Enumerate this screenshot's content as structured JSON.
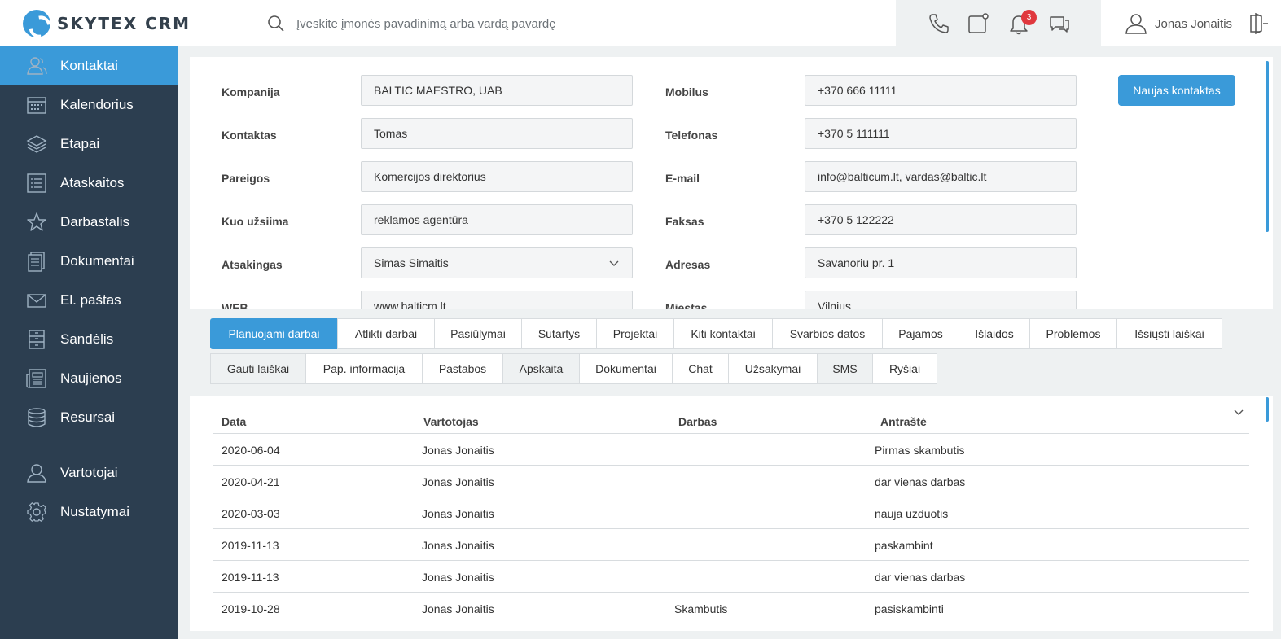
{
  "app": {
    "logo_text": "SKYTEX CRM",
    "logo_icon": "skytex-logo-icon",
    "accent_color": "#3a9ad9",
    "sidebar_color": "#2c3e50"
  },
  "header": {
    "search": {
      "placeholder": "Įveskite įmonės pavadinimą arba vardą pavardę",
      "icon": "search-icon"
    },
    "icons": [
      "phone-icon",
      "note-icon",
      "bell-icon",
      "chat-icon"
    ],
    "notification_count": "3",
    "user_name": "Jonas Jonaitis",
    "logout_icon": "logout-icon"
  },
  "sidebar": {
    "items": [
      {
        "label": "Kontaktai",
        "icon": "contacts-icon",
        "active": true
      },
      {
        "label": "Kalendorius",
        "icon": "calendar-icon"
      },
      {
        "label": "Etapai",
        "icon": "layers-icon"
      },
      {
        "label": "Ataskaitos",
        "icon": "list-icon"
      },
      {
        "label": "Darbastalis",
        "icon": "star-icon"
      },
      {
        "label": "Dokumentai",
        "icon": "document-icon"
      },
      {
        "label": "El. paštas",
        "icon": "mail-icon"
      },
      {
        "label": "Sandėlis",
        "icon": "warehouse-icon"
      },
      {
        "label": "Naujienos",
        "icon": "news-icon"
      },
      {
        "label": "Resursai",
        "icon": "database-icon"
      },
      {
        "label": "Vartotojai",
        "icon": "user-icon"
      },
      {
        "label": "Nustatymai",
        "icon": "gear-icon"
      }
    ]
  },
  "contact": {
    "new_contact_button": "Naujas kontaktas",
    "left_fields": [
      {
        "label": "Kompanija",
        "value": "BALTIC MAESTRO, UAB"
      },
      {
        "label": "Kontaktas",
        "value": "Tomas"
      },
      {
        "label": "Pareigos",
        "value": "Komercijos direktorius"
      },
      {
        "label": "Kuo užsiima",
        "value": "reklamos agentūra"
      },
      {
        "label": "Atsakingas",
        "value": "Simas Simaitis"
      },
      {
        "label": "WEB",
        "value": "www.balticm.lt"
      }
    ],
    "right_fields": [
      {
        "label": "Mobilus",
        "value": "+370 666 11111"
      },
      {
        "label": "Telefonas",
        "value": "+370 5 111111"
      },
      {
        "label": "E-mail",
        "value": "info@balticum.lt, vardas@baltic.lt"
      },
      {
        "label": "Faksas",
        "value": "+370 5 122222"
      },
      {
        "label": "Adresas",
        "value": "Savanoriu pr. 1"
      },
      {
        "label": "Miestas",
        "value": "Vilnius"
      }
    ]
  },
  "tabs": {
    "row1": [
      "Planuojami darbai",
      "Atlikti darbai",
      "Pasiūlymai",
      "Sutartys",
      "Projektai",
      "Kiti kontaktai",
      "Svarbios datos",
      "Pajamos",
      "Išlaidos",
      "Problemos",
      "Išsiųsti laiškai"
    ],
    "row2": [
      "Gauti laiškai",
      "Pap. informacija",
      "Pastabos",
      "Apskaita",
      "Dokumentai",
      "Chat",
      "Užsakymai",
      "SMS",
      "Ryšiai"
    ]
  },
  "table": {
    "columns": [
      "Data",
      "Vartotojas",
      "Darbas",
      "Antraštė"
    ],
    "rows": [
      [
        "2020-06-04",
        "Jonas Jonaitis",
        "",
        "Pirmas skambutis"
      ],
      [
        "2020-04-21",
        "Jonas Jonaitis",
        "",
        "dar vienas darbas"
      ],
      [
        "2020-03-03",
        "Jonas Jonaitis",
        "",
        "nauja uzduotis"
      ],
      [
        "2019-11-13",
        "Jonas Jonaitis",
        "",
        "paskambint"
      ],
      [
        "2019-11-13",
        "Jonas Jonaitis",
        "",
        "dar vienas darbas"
      ],
      [
        "2019-10-28",
        "Jonas Jonaitis",
        "Skambutis",
        "pasiskambinti"
      ]
    ]
  }
}
